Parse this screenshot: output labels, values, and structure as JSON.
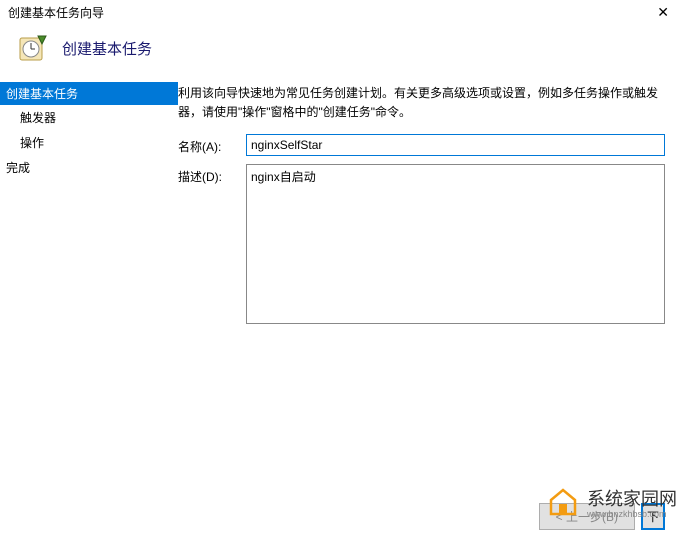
{
  "titlebar": {
    "title": "创建基本任务向导"
  },
  "header": {
    "title": "创建基本任务"
  },
  "sidebar": {
    "items": [
      {
        "label": "创建基本任务",
        "active": true
      },
      {
        "label": "触发器",
        "active": false
      },
      {
        "label": "操作",
        "active": false
      },
      {
        "label": "完成",
        "active": false
      }
    ]
  },
  "main": {
    "description": "利用该向导快速地为常见任务创建计划。有关更多高级选项或设置，例如多任务操作或触发器，请使用\"操作\"窗格中的\"创建任务\"命令。",
    "name_label": "名称(A):",
    "name_value": "nginxSelfStar",
    "description_label": "描述(D):",
    "description_value": "nginx自启动"
  },
  "footer": {
    "back_button": "< 上一步(B)",
    "next_button": "下"
  },
  "watermark": {
    "text": "系统家园网",
    "url": "www.hnzkhbsb.com"
  }
}
